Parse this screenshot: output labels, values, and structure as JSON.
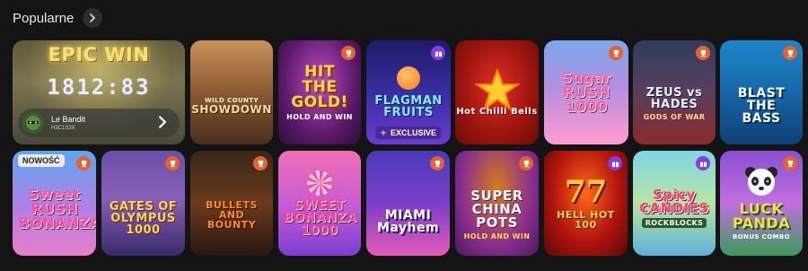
{
  "section": {
    "title": "Popularne"
  },
  "featured": {
    "banner": "EPIC WIN",
    "counter": "1812:83",
    "player_name": "Le Bandit",
    "player_id": "H3C1S3X"
  },
  "games_row1": [
    {
      "logo": "SHOWDOWN",
      "sub": "WILD COUNTY",
      "badge": ""
    },
    {
      "logo": "HIT THE GOLD!",
      "sub": "HOLD AND WIN",
      "badge": "orange"
    },
    {
      "logo": "FLAGMAN FRUITS",
      "sub": "",
      "badge": "purple",
      "exclusive": "EXCLUSIVE"
    },
    {
      "logo": "Hot Chilli Bells",
      "sub": "",
      "badge": ""
    },
    {
      "logo": "Sugar RUSH 1000",
      "sub": "",
      "badge": "orange"
    },
    {
      "logo": "ZEUS vs HADES",
      "sub": "GODS OF WAR",
      "badge": "orange"
    },
    {
      "logo": "BLAST THE BASS",
      "sub": "",
      "badge": "orange"
    }
  ],
  "games_row2": [
    {
      "logo": "Sweet RUSH BONANZA",
      "sub": "",
      "badge": "orange",
      "new": "NOWOŚĆ"
    },
    {
      "logo": "GATES OF OLYMPUS 1000",
      "sub": "",
      "badge": "orange"
    },
    {
      "logo": "BULLETS AND BOUNTY",
      "sub": "",
      "badge": "orange"
    },
    {
      "logo": "SWEET BONANZA 1000",
      "sub": "",
      "badge": ""
    },
    {
      "logo": "MIAMI Mayhem",
      "sub": "",
      "badge": "orange"
    },
    {
      "logo": "SUPER CHINA POTS",
      "sub": "HOLD AND WIN",
      "badge": "orange"
    },
    {
      "logo": "HELL HOT 100",
      "sub": "",
      "badge": "purple"
    },
    {
      "logo": "Spicy CANDIES",
      "sub": "ROCKBLOCKS",
      "badge": "purple"
    },
    {
      "logo": "LUCK PANDA",
      "sub": "BONUS COMBO",
      "badge": "orange"
    }
  ],
  "colors": {
    "background": "#141414",
    "badge_orange": "#e8602c",
    "badge_purple": "#8a3bd9"
  },
  "icons": {
    "scroll": "chevron-right-icon",
    "tile_badge_orange": "trophy-icon",
    "tile_badge_purple": "gift-icon"
  }
}
